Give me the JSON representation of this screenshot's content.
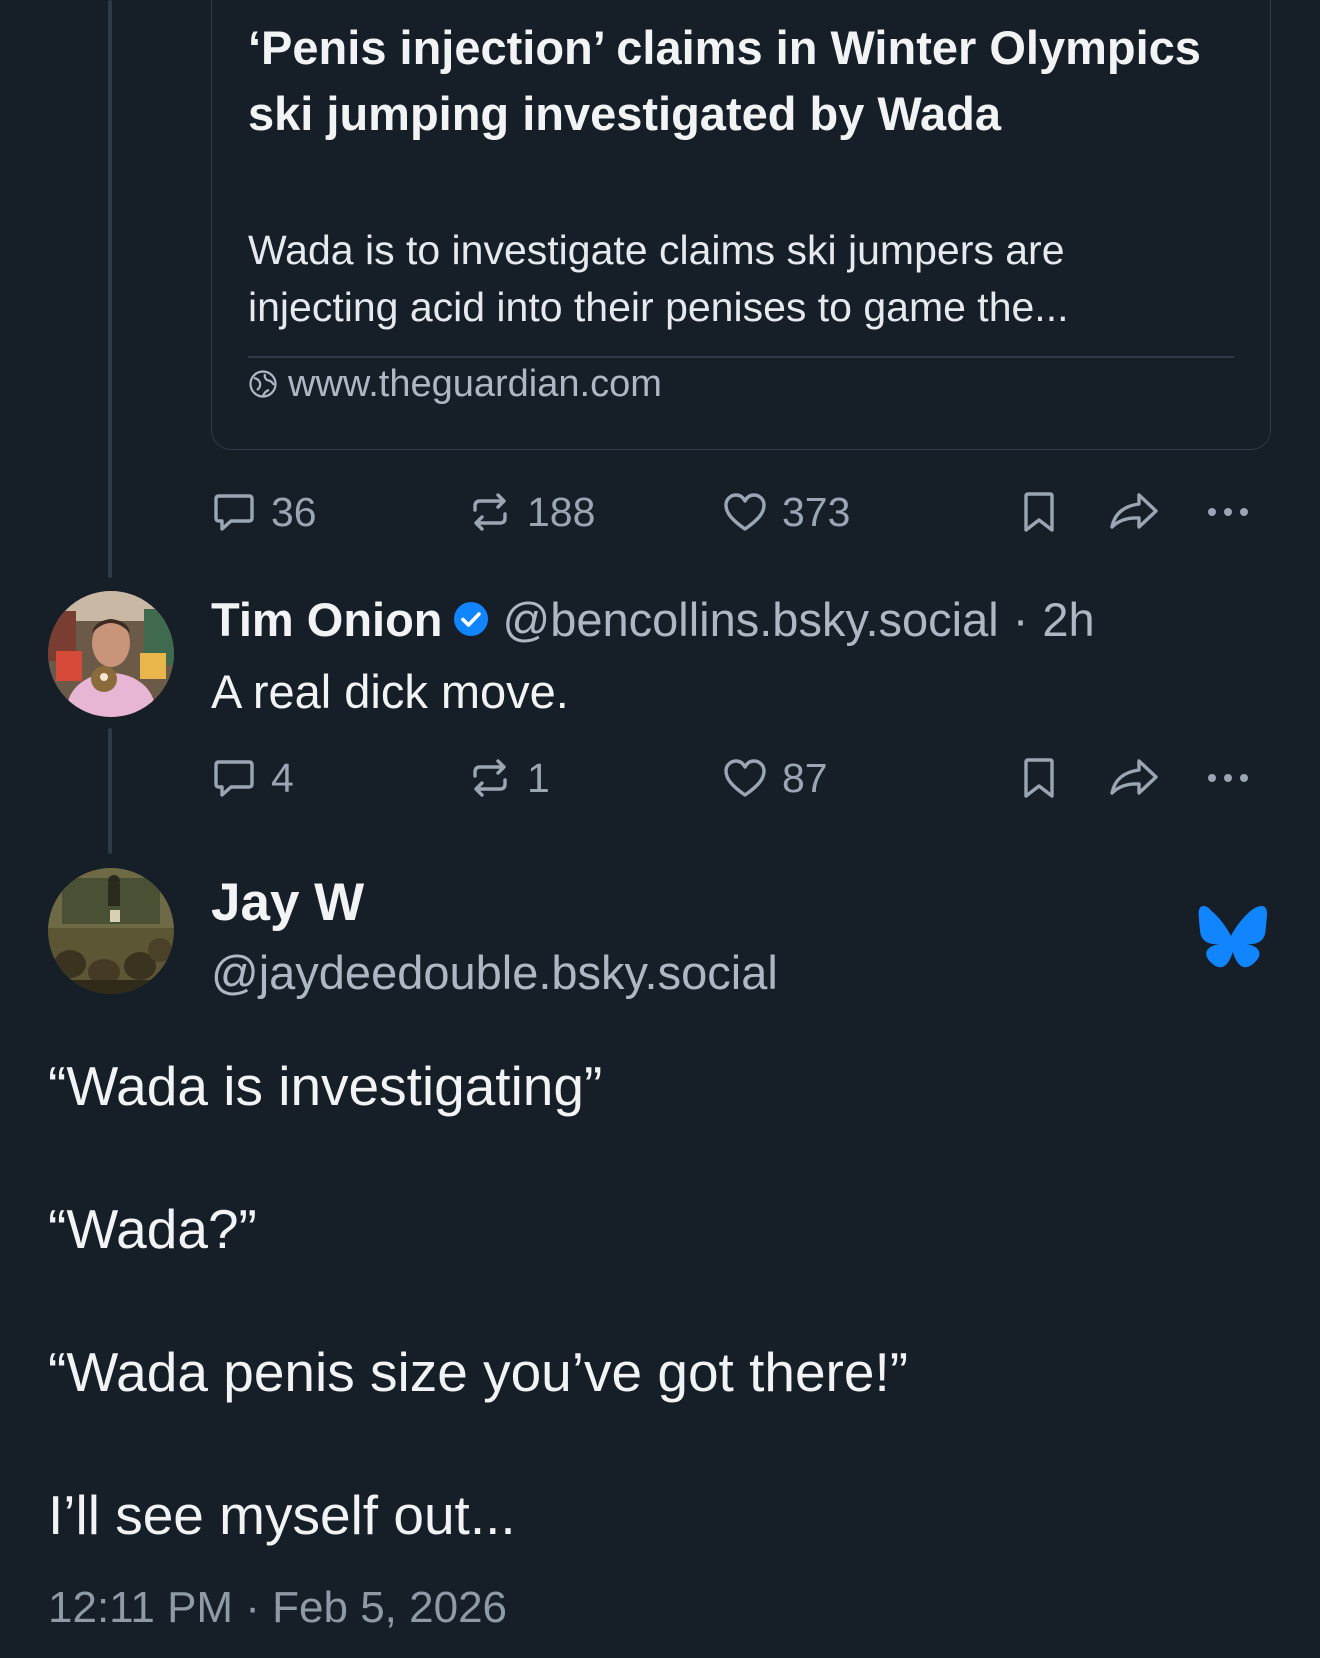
{
  "link_card": {
    "title": "‘Penis injection’ claims in Winter Olympics ski jumping investigated by Wada",
    "description_line1": "Wada is to investigate claims ski jumpers are",
    "description_line2": "injecting acid into their penises to game the...",
    "domain": "www.theguardian.com",
    "domain_icon": "globe-icon"
  },
  "post1_actions": {
    "replies": "36",
    "reposts": "188",
    "likes": "373"
  },
  "reply": {
    "author_name": "Tim Onion",
    "verified_icon": "verified-badge-icon",
    "handle": "@bencollins.bsky.social",
    "separator": "·",
    "time_ago": "2h",
    "text": "A real dick move.",
    "actions": {
      "replies": "4",
      "reposts": "1",
      "likes": "87"
    }
  },
  "main_post": {
    "author_name": "Jay W",
    "handle": "@jaydeedouble.bsky.social",
    "logo_icon": "bluesky-butterfly-icon",
    "lines": [
      "“Wada is investigating”",
      "“Wada?”",
      "“Wada penis size you’ve got there!”",
      "I’ll see myself out..."
    ],
    "timestamp": "12:11 PM · Feb 5, 2026"
  },
  "colors": {
    "background": "#161e27",
    "text": "#f1f3f5",
    "muted": "#aeb8c4",
    "icon": "#9aa6b4",
    "border": "#2e3a47",
    "accent": "#1185fe"
  }
}
